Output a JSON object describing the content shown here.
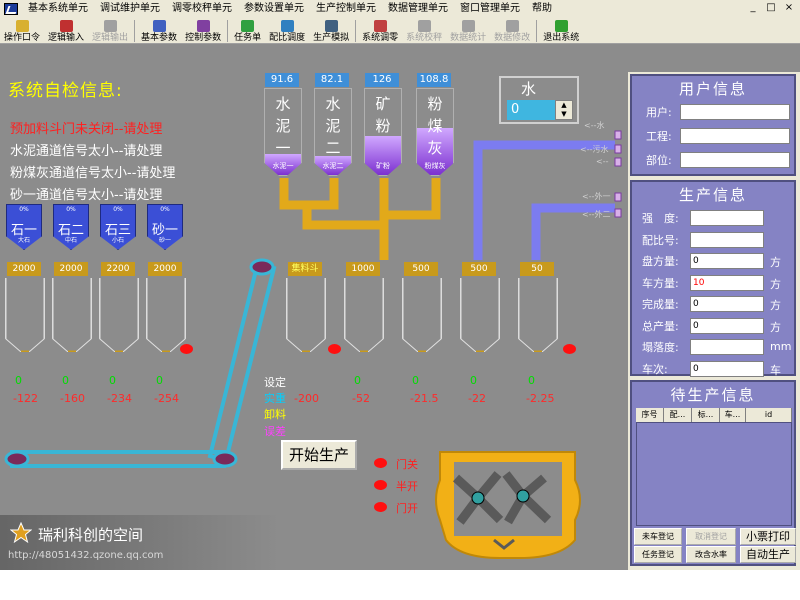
{
  "menu": [
    "基本系统单元",
    "调试维护单元",
    "调零校秤单元",
    "参数设置单元",
    "生产控制单元",
    "数据管理单元",
    "窗口管理单元",
    "帮助"
  ],
  "window_controls": [
    "_",
    "□",
    "×"
  ],
  "toolbar": [
    {
      "label": "操作口令",
      "icon": "key-icon",
      "color": "#d8b030",
      "disabled": false
    },
    {
      "label": "逻辑输入",
      "icon": "pencil-icon",
      "color": "#c03030",
      "disabled": false
    },
    {
      "label": "逻辑输出",
      "icon": "cursor-icon",
      "color": "#a0a0a0",
      "disabled": true
    },
    {
      "label": "基本参数",
      "icon": "document-icon",
      "color": "#4060c0",
      "disabled": false
    },
    {
      "label": "控制参数",
      "icon": "document-icon",
      "color": "#8040a0",
      "disabled": false
    },
    {
      "label": "任务单",
      "icon": "folder-icon",
      "color": "#30a040",
      "disabled": false
    },
    {
      "label": "配比调度",
      "icon": "grid-icon",
      "color": "#3080c0",
      "disabled": false
    },
    {
      "label": "生产模拟",
      "icon": "monitor-icon",
      "color": "#406080",
      "disabled": false
    },
    {
      "label": "系统调零",
      "icon": "truck-icon",
      "color": "#c04040",
      "disabled": false
    },
    {
      "label": "系统校秤",
      "icon": "balance-icon",
      "color": "#a0a0a0",
      "disabled": true
    },
    {
      "label": "数据统计",
      "icon": "chart-icon",
      "color": "#a0a0a0",
      "disabled": true
    },
    {
      "label": "数据修改",
      "icon": "edit-icon",
      "color": "#a0a0a0",
      "disabled": true
    },
    {
      "label": "退出系统",
      "icon": "exit-icon",
      "color": "#30a030",
      "disabled": false
    }
  ],
  "self_check": {
    "title": "系统自检信息:",
    "messages": [
      {
        "text": "预加料斗门未关闭--请处理",
        "color": "#ff2020"
      },
      {
        "text": "水泥通道信号太小--请处理",
        "color": "#ffffff"
      },
      {
        "text": "粉煤灰通道信号太小--请处理",
        "color": "#ffffff"
      },
      {
        "text": "砂一通道信号太小--请处理",
        "color": "#ffffff"
      }
    ]
  },
  "powder_silos": [
    {
      "value": "91.6",
      "chars": [
        "水",
        "泥",
        "一"
      ],
      "sub": "水泥一",
      "fill": 0.25
    },
    {
      "value": "82.1",
      "chars": [
        "水",
        "泥",
        "二"
      ],
      "sub": "水泥二",
      "fill": 0.22
    },
    {
      "value": "126",
      "chars": [
        "矿",
        "粉"
      ],
      "sub": "矿粉",
      "fill": 0.45
    },
    {
      "value": "108.8",
      "chars": [
        "粉",
        "煤",
        "灰"
      ],
      "sub": "粉煤灰",
      "fill": 0.55
    }
  ],
  "aggregates": [
    {
      "pct": "0%",
      "name": "石一",
      "sub": "大石"
    },
    {
      "pct": "0%",
      "name": "石二",
      "sub": "中石"
    },
    {
      "pct": "0%",
      "name": "石三",
      "sub": "小石"
    },
    {
      "pct": "0%",
      "name": "砂一",
      "sub": "砂一"
    }
  ],
  "aggregate_bins": [
    {
      "label": "2000",
      "zero": "0",
      "value": "-122"
    },
    {
      "label": "2000",
      "zero": "0",
      "value": "-160"
    },
    {
      "label": "2200",
      "zero": "0",
      "value": "-234"
    },
    {
      "label": "2000",
      "zero": "0",
      "value": "-254"
    }
  ],
  "weigh_bins": [
    {
      "label": "集料斗",
      "zero": "",
      "value": "-200"
    },
    {
      "label": "1000",
      "zero": "0",
      "value": "-52"
    },
    {
      "label": "500",
      "zero": "0",
      "value": "-21.5"
    },
    {
      "label": "500",
      "zero": "0",
      "value": "-22"
    },
    {
      "label": "50",
      "zero": "0",
      "value": "-2.25"
    }
  ],
  "legend": {
    "set": "设定",
    "actual": "实重",
    "discharge": "卸料",
    "error": "误差"
  },
  "start_button": "开始生产",
  "water": {
    "title": "水",
    "value": "0"
  },
  "arrow_labels": [
    "<--水",
    "<--污水",
    "<--",
    "<--外一",
    "<--外二"
  ],
  "door_status": [
    "门关",
    "半开",
    "门开"
  ],
  "user_info": {
    "title": "用户信息",
    "fields": [
      {
        "label": "用户:",
        "value": ""
      },
      {
        "label": "工程:",
        "value": ""
      },
      {
        "label": "部位:",
        "value": ""
      }
    ]
  },
  "production_info": {
    "title": "生产信息",
    "fields": [
      {
        "label": "强　度:",
        "value": "",
        "unit": ""
      },
      {
        "label": "配比号:",
        "value": "",
        "unit": ""
      },
      {
        "label": "盘方量:",
        "value": "0",
        "unit": "方"
      },
      {
        "label": "车方量:",
        "value": "10",
        "unit": "方"
      },
      {
        "label": "完成量:",
        "value": "0",
        "unit": "方"
      },
      {
        "label": "总产量:",
        "value": "0",
        "unit": "方"
      },
      {
        "label": "塌落度:",
        "value": "",
        "unit": "mm"
      },
      {
        "label": "车次:",
        "value": "0",
        "unit": "车"
      }
    ]
  },
  "pending_info": {
    "title": "待生产信息",
    "columns": [
      "序号",
      "配...",
      "标...",
      "车...",
      "id"
    ]
  },
  "pending_buttons": [
    {
      "label": "未车登记",
      "disabled": false
    },
    {
      "label": "取消登记",
      "disabled": true
    },
    {
      "label": "小票打印",
      "disabled": false
    },
    {
      "label": "任务登记",
      "disabled": false
    },
    {
      "label": "改含水率",
      "disabled": false
    },
    {
      "label": "自动生产",
      "disabled": false
    }
  ],
  "watermark": {
    "title": "瑞利科创的空间",
    "url": "http://48051432.qzone.qq.com"
  },
  "colors": {
    "gray": "#8c8c8c",
    "belt": "#39b6d6",
    "pipe_gold": "#e2a91a",
    "pipe_purple": "#7c7cf0",
    "panel": "#8583c4",
    "mixer": "#f2b016"
  }
}
